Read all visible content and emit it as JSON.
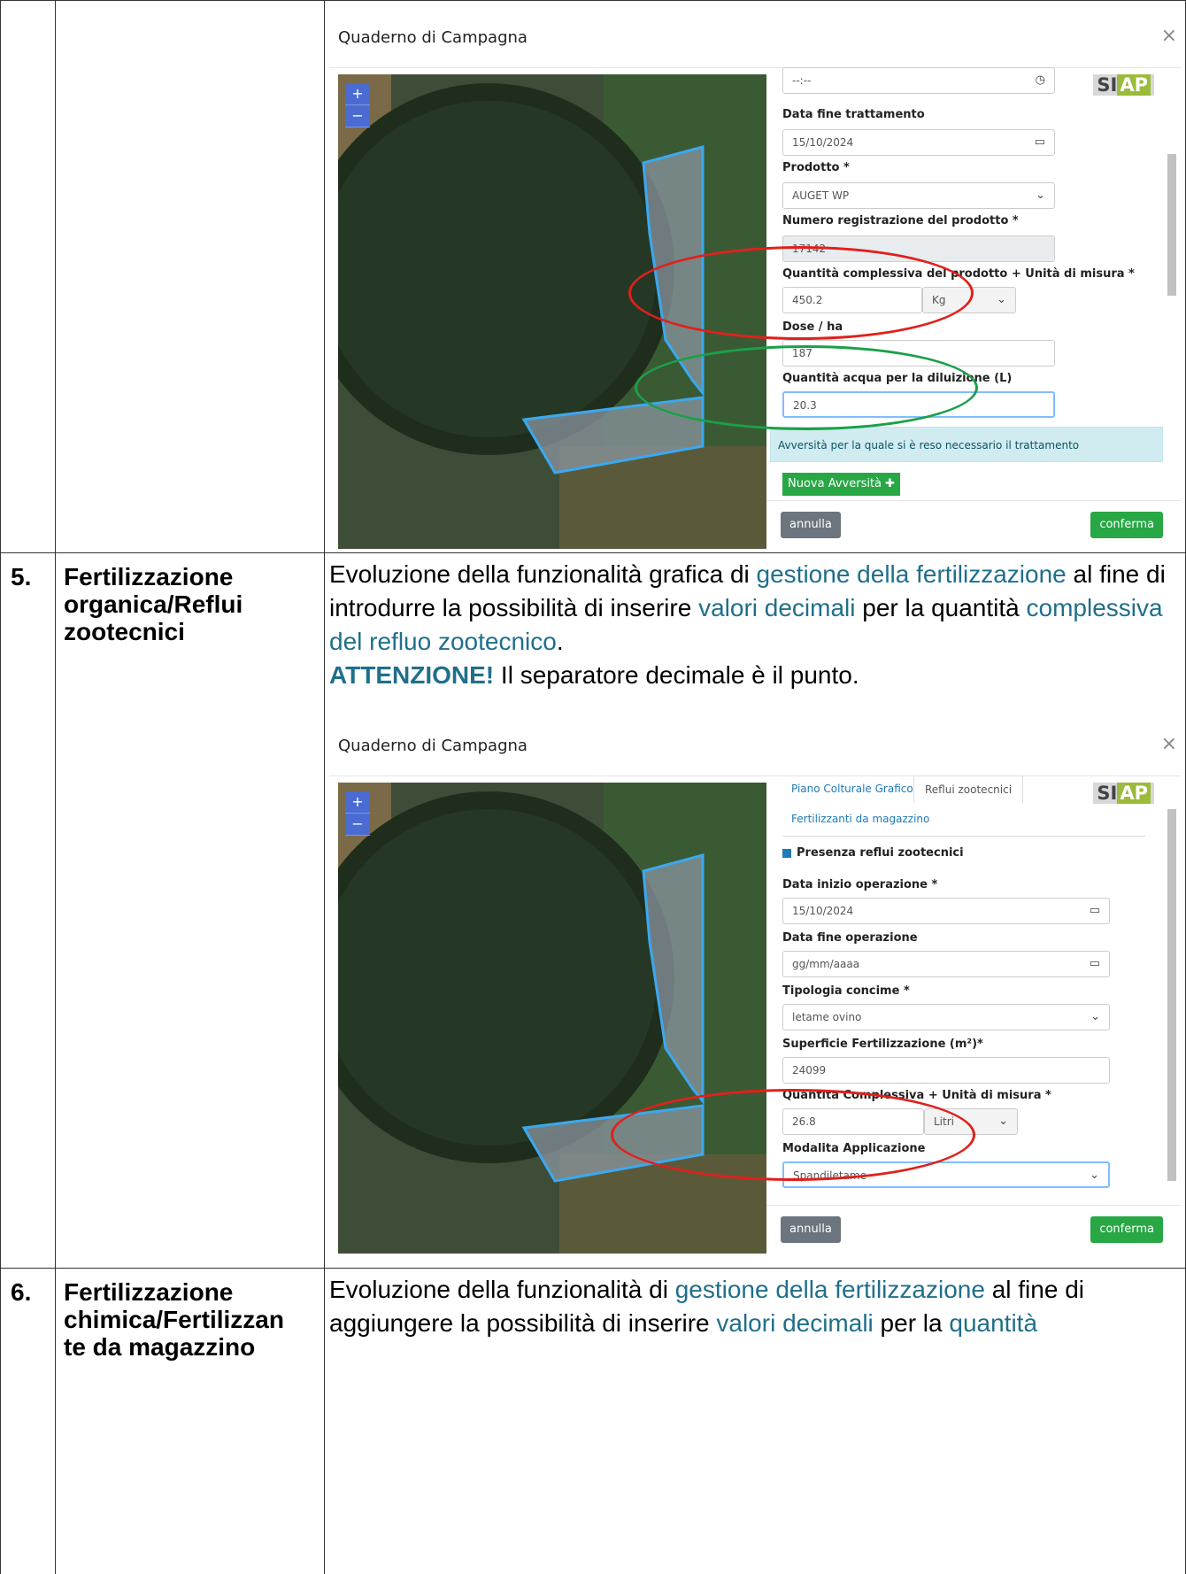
{
  "rows": [
    {
      "number": "5.",
      "title": "Fertilizzazione organica/Reflui zootecnici",
      "desc": {
        "t1": "Evoluzione della funzionalità grafica di ",
        "l1": "gestione della fertilizzazione",
        "t2": " al fine di introdurre la possibilità di inserire ",
        "l2": "valori decimali",
        "t3": " per la quantità ",
        "l3": "complessiva del refluo zootecnico",
        "t4": ".",
        "attention": "ATTENZIONE!",
        "t5": " Il separatore decimale è il punto."
      }
    },
    {
      "number": "6.",
      "title": "Fertilizzazione chimica/Fertilizzan te da magazzino",
      "desc": {
        "t1": "Evoluzione della funzionalità di ",
        "l1": "gestione della fertilizzazione",
        "t2": " al fine di aggiungere la possibilità di inserire ",
        "l2": "valori decimali",
        "t3": " per la ",
        "l3": "quantità"
      }
    }
  ],
  "shot1": {
    "title": "Quaderno di Campagna",
    "close": "×",
    "logo": {
      "a": "SI",
      "b": "AP"
    },
    "time_value": "--:--",
    "fields": [
      {
        "label": "Data fine trattamento",
        "value": "15/10/2024"
      },
      {
        "label": "Prodotto *",
        "value": "AUGET WP"
      },
      {
        "label": "Numero registrazione del prodotto *",
        "value": "17142"
      },
      {
        "label": "Quantità complessiva del prodotto + Unità di misura *",
        "value": "450.2",
        "unit": "Kg"
      },
      {
        "label": "Dose / ha",
        "value": "187"
      },
      {
        "label": "Quantità acqua per la diluizione (L)",
        "value": "20.3"
      }
    ],
    "info": "Avversità per la quale si è reso necessario il trattamento",
    "new_button": "Nuova Avversità",
    "cancel": "annulla",
    "confirm": "conferma",
    "annotation_colors": {
      "red": "#e0201b",
      "green": "#1aa04a"
    }
  },
  "shot2": {
    "title": "Quaderno di Campagna",
    "close": "×",
    "logo": {
      "a": "SI",
      "b": "AP"
    },
    "tabs": [
      "Piano Colturale Grafico",
      "Reflui zootecnici",
      "Fertilizzanti da magazzino"
    ],
    "checkbox": "Presenza reflui zootecnici",
    "fields": [
      {
        "label": "Data inizio operazione *",
        "value": "15/10/2024"
      },
      {
        "label": "Data fine operazione",
        "value": "gg/mm/aaaa"
      },
      {
        "label": "Tipologia concime *",
        "value": "letame ovino"
      },
      {
        "label": "Superficie Fertilizzazione (m²)*",
        "value": "24099"
      },
      {
        "label": "Quantita Complessiva + Unità di misura *",
        "value": "26.8",
        "unit": "Litri"
      },
      {
        "label": "Modalita Applicazione",
        "value": "Spandiletame"
      }
    ],
    "cancel": "annulla",
    "confirm": "conferma"
  }
}
